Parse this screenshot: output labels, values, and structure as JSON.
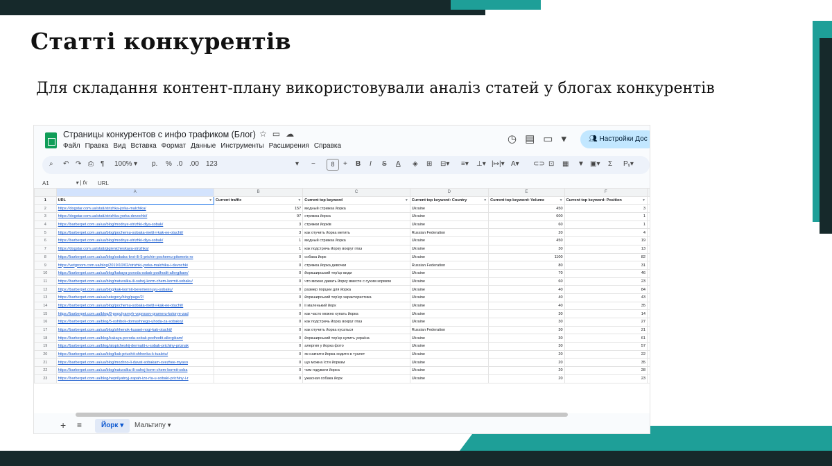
{
  "slide": {
    "title": "Статті конкурентів",
    "subtitle": "Для складання контент-плану використовували аналіз статей у блогах конкурентів"
  },
  "colors": {
    "dark": "#16292b",
    "teal": "#1e9f98",
    "share": "#c2e7ff"
  },
  "sheet": {
    "doc_title": "Страницы конкурентов с инфо трафиком (Блог)",
    "menu": [
      "Файл",
      "Правка",
      "Вид",
      "Вставка",
      "Формат",
      "Данные",
      "Инструменты",
      "Расширения",
      "Справка"
    ],
    "share_label": "Настройки Дос",
    "toolbar": {
      "zoom": "100%",
      "font_size": "8",
      "number_format": "123"
    },
    "cell_ref": "A1",
    "formula_value": "URL",
    "columns": [
      "A",
      "B",
      "C",
      "D",
      "E",
      "F"
    ],
    "header_row": [
      "URL",
      "Current traffic",
      "Current top keyword",
      "Current top keyword: Country",
      "Current top keyword: Volume",
      "Current top keyword: Position"
    ],
    "rows": [
      [
        "https://dogstar.com.ua/stati/strizhka-jorka-malchika/",
        "157",
        "модный стрижка йорка",
        "Ukraine",
        "450",
        "3"
      ],
      [
        "https://dogstar.com.ua/stati/strizhka-yorka-devochki/",
        "97",
        "стрижка йорка",
        "Ukraine",
        "600",
        "1"
      ],
      [
        "https://barberpet.com.ua/ua/blog/modnye-strizhki-dlya-sobak/",
        "3",
        "стрижки йорків",
        "Ukraine",
        "60",
        "1"
      ],
      [
        "https://barberpet.com.ua/ua/blog/pochemu-sobaka-metit-i-kak-ee-otuchit/",
        "3",
        "как отучить йорка метить",
        "Russian Federation",
        "20",
        "4"
      ],
      [
        "https://barberpet.com.ua/ua/blog/modnye-strizhki-dlya-sobak/",
        "1",
        "модный стрижка йорка",
        "Ukraine",
        "450",
        "19"
      ],
      [
        "https://dogstar.com.ua/stati/gigienicheskaya-strizhka/",
        "1",
        "как подстричь йорку вокруг глаз",
        "Ukraine",
        "30",
        "13"
      ],
      [
        "https://barberpet.com.ua/ua/blog/sobaka-krot-ili-5-prichin-pochemu-pitomets-ro",
        "0",
        "собака йорк",
        "Ukraine",
        "1100",
        "82"
      ],
      [
        "https://vetgroom.com.ua/blog/2019/10/02/strizhki-yorka-malchika-i-devochki",
        "0",
        "стрижка йорка девочки",
        "Russian Federation",
        "80",
        "31"
      ],
      [
        "https://barberpet.com.ua/ua/blog/kakaya-poroda-sobak-podhodit-allergikam/",
        "0",
        "йоркширський тер'єр види",
        "Ukraine",
        "70",
        "46"
      ],
      [
        "https://barberpet.com.ua/ua/blog/naturalka-ili-suhoj-korm-chem-kormit-sobaku/",
        "0",
        "что можно давать йорку вместе с сухим кормом",
        "Ukraine",
        "60",
        "23"
      ],
      [
        "https://barberpet.com.ua/ua/blog/kak-kormit-beremennuyu-sobaku/",
        "0",
        "размер порции для йорка",
        "Ukraine",
        "40",
        "84"
      ],
      [
        "https://barberpet.com.ua/ua/category/blog/page/2/",
        "0",
        "йоркширський тер'єр характеристика",
        "Ukraine",
        "40",
        "43"
      ],
      [
        "https://barberpet.com.ua/ua/blog/pochemu-sobaka-metit-i-kak-ee-otuchit/",
        "0",
        "іі маленький йорк",
        "Ukraine",
        "40",
        "35"
      ],
      [
        "https://barberpet.com.ua/blog/8-populyarnyh-voprosov-grumeru-kotorye-zad",
        "0",
        "как часто можно купать йорка",
        "Ukraine",
        "30",
        "14"
      ],
      [
        "https://barberpet.com.ua/blog/5-oshibok-domashnego-uhoda-za-sobakoj/",
        "0",
        "как подстричь йорку вокруг глаз",
        "Ukraine",
        "30",
        "27"
      ],
      [
        "https://barberpet.com.ua/ua/blog/shhenok-kusaet-nogi-kak-otuchit/",
        "0",
        "как отучить йорка кусаться",
        "Russian Federation",
        "30",
        "21"
      ],
      [
        "https://barberpet.com.ua/blog/kakaya-poroda-sobak-podhodit-allergikam/",
        "0",
        "йоркширський тер'єр купить україна",
        "Ukraine",
        "30",
        "61"
      ],
      [
        "https://barberpet.com.ua/blog/atopicheskij-dermatit-u-sobak-prichiny-priznak",
        "0",
        "алергия у йорка фото",
        "Ukraine",
        "30",
        "57"
      ],
      [
        "https://barberpet.com.ua/ua/blog/kak-priuchit-shhenka-k-tualetu/",
        "0",
        "як навчити йорка ходити в туалет",
        "Ukraine",
        "20",
        "22"
      ],
      [
        "https://barberpet.com.ua/ua/blog/mozhno-li-davat-sobakam-svezhee-myaso",
        "0",
        "що можна їсти йоркам",
        "Ukraine",
        "20",
        "35"
      ],
      [
        "https://barberpet.com.ua/ua/blog/naturalka-ili-suhoj-korm-chem-kormit-soba",
        "0",
        "чим годувати йорка",
        "Ukraine",
        "20",
        "28"
      ],
      [
        "https://barberpet.com.ua/blog/neprilyatnyj-zapah-izo-rta-u-sobaki-prichiny-i-r",
        "0",
        "ужасная собака йорк",
        "Ukraine",
        "20",
        "23"
      ]
    ],
    "tabs": [
      "Йорк",
      "Мальтипу"
    ]
  }
}
